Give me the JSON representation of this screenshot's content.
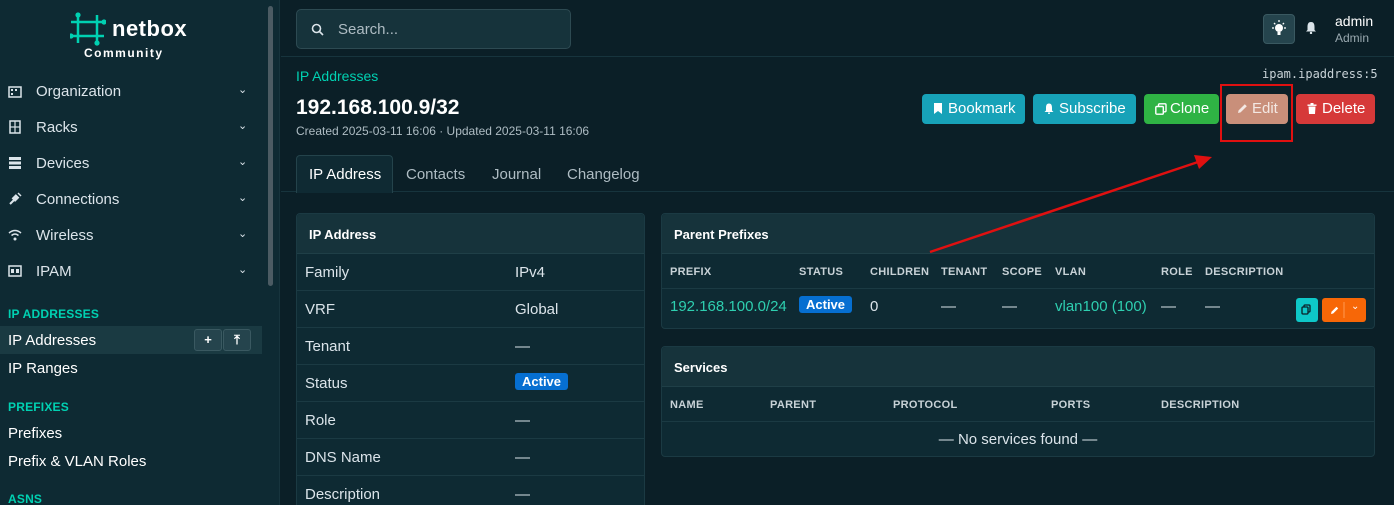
{
  "brand": {
    "name": "netbox",
    "edition": "Community"
  },
  "sidebar": {
    "menus": [
      {
        "label": "Organization",
        "icon": "building-icon"
      },
      {
        "label": "Racks",
        "icon": "rack-icon"
      },
      {
        "label": "Devices",
        "icon": "server-icon"
      },
      {
        "label": "Connections",
        "icon": "plug-icon"
      },
      {
        "label": "Wireless",
        "icon": "wifi-icon"
      },
      {
        "label": "IPAM",
        "icon": "counter-icon"
      }
    ],
    "sections": [
      {
        "heading": "IP ADDRESSES",
        "items": [
          "IP Addresses",
          "IP Ranges"
        ]
      },
      {
        "heading": "PREFIXES",
        "items": [
          "Prefixes",
          "Prefix & VLAN Roles"
        ]
      },
      {
        "heading": "ASNS",
        "items": []
      }
    ],
    "active_item": "IP Addresses",
    "add_glyph": "+",
    "import_glyph": "⤒"
  },
  "topbar": {
    "search_placeholder": "Search...",
    "user": {
      "name": "admin",
      "role": "Admin"
    }
  },
  "page": {
    "breadcrumb": "IP Addresses",
    "object_id": "ipam.ipaddress:5",
    "title": "192.168.100.9/32",
    "meta": "Created 2025-03-11 16:06 · Updated 2025-03-11 16:06",
    "actions": {
      "bookmark": "Bookmark",
      "subscribe": "Subscribe",
      "clone": "Clone",
      "edit": "Edit",
      "delete": "Delete"
    },
    "tabs": [
      "IP Address",
      "Contacts",
      "Journal",
      "Changelog"
    ]
  },
  "ip_card": {
    "title": "IP Address",
    "rows": [
      {
        "key": "Family",
        "value": "IPv4"
      },
      {
        "key": "VRF",
        "value": "Global"
      },
      {
        "key": "Tenant",
        "value": "—"
      },
      {
        "key": "Status",
        "value": "Active"
      },
      {
        "key": "Role",
        "value": "—"
      },
      {
        "key": "DNS Name",
        "value": "—"
      },
      {
        "key": "Description",
        "value": "—"
      }
    ]
  },
  "parent_prefixes": {
    "title": "Parent Prefixes",
    "columns": [
      "PREFIX",
      "STATUS",
      "CHILDREN",
      "TENANT",
      "SCOPE",
      "VLAN",
      "ROLE",
      "DESCRIPTION"
    ],
    "rows": [
      {
        "prefix": "192.168.100.0/24",
        "status": "Active",
        "children": "0",
        "tenant": "—",
        "scope": "—",
        "vlan": "vlan100 (100)",
        "role": "—",
        "description": "—"
      }
    ]
  },
  "services": {
    "title": "Services",
    "columns": [
      "NAME",
      "PARENT",
      "PROTOCOL",
      "PORTS",
      "DESCRIPTION"
    ],
    "empty": "— No services found —"
  },
  "colors": {
    "accent": "#00d1b2",
    "status_active": "#066fd1",
    "info": "#17a2b8",
    "success": "#2fb344",
    "danger": "#d63939",
    "annotation": "#e01010"
  }
}
